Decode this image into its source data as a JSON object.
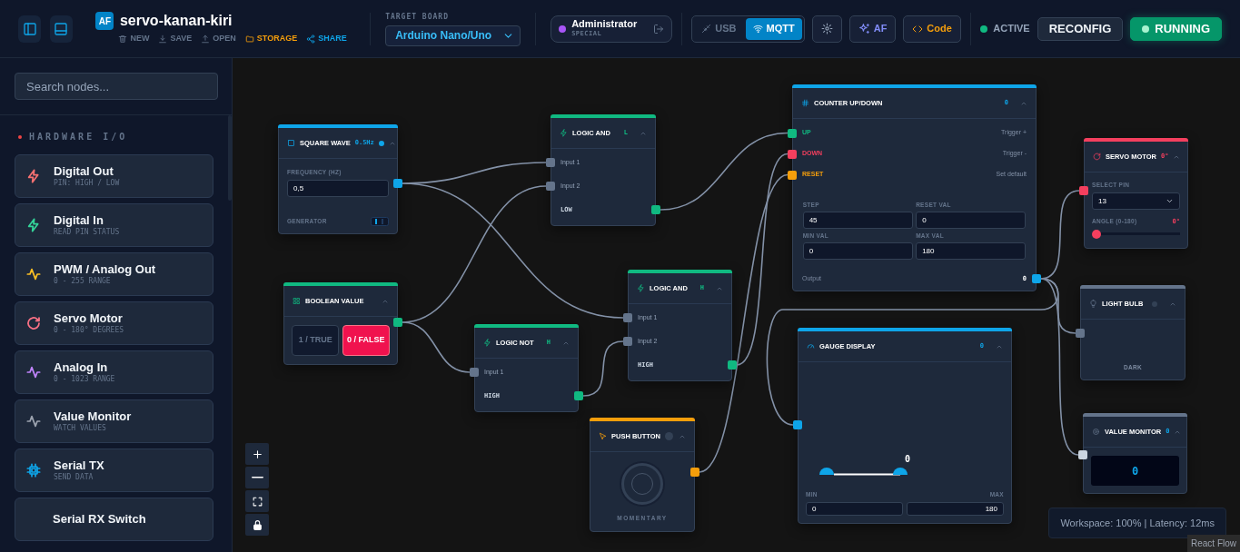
{
  "header": {
    "logo": "AF",
    "project_name": "servo-kanan-kiri",
    "actions": [
      {
        "label": "NEW",
        "kind": "new"
      },
      {
        "label": "SAVE",
        "kind": "save"
      },
      {
        "label": "OPEN",
        "kind": "open"
      },
      {
        "label": "STORAGE",
        "kind": "storage"
      },
      {
        "label": "SHARE",
        "kind": "share"
      }
    ],
    "target_board": {
      "label": "TARGET BOARD",
      "value": "Arduino Nano/Uno"
    },
    "user": {
      "name": "Administrator",
      "role": "SPECIAL"
    },
    "connection_modes": [
      {
        "label": "USB",
        "kind": "usb",
        "selected": false
      },
      {
        "label": "MQTT",
        "kind": "mqtt",
        "selected": true
      }
    ],
    "ai_button": "AF",
    "code_button": "Code",
    "status": {
      "label": "ACTIVE",
      "on": true
    },
    "reconfig_button": "RECONFIG",
    "run_button": {
      "label": "RUNNING",
      "running": true
    }
  },
  "sidebar": {
    "search": {
      "placeholder": "Search nodes..."
    },
    "section": {
      "title": "HARDWARE I/O",
      "color": "#ef4444"
    },
    "items": [
      {
        "title": "Digital Out",
        "subtitle": "PIN: HIGH / LOW",
        "kind": "bolt",
        "color": "#f87171"
      },
      {
        "title": "Digital In",
        "subtitle": "READ PIN STATUS",
        "kind": "bolt",
        "color": "#34d399"
      },
      {
        "title": "PWM / Analog Out",
        "subtitle": "0 - 255 RANGE",
        "kind": "wave",
        "color": "#fbbf24"
      },
      {
        "title": "Servo Motor",
        "subtitle": "0 - 180° DEGREES",
        "kind": "refresh",
        "color": "#fb7185"
      },
      {
        "title": "Analog In",
        "subtitle": "0 - 1023 RANGE",
        "kind": "wave",
        "color": "#c084fc"
      },
      {
        "title": "Value Monitor",
        "subtitle": "WATCH VALUES",
        "kind": "wave",
        "color": "#9ca3af"
      },
      {
        "title": "Serial TX",
        "subtitle": "SEND DATA",
        "kind": "chip",
        "color": "#0ea5e9"
      },
      {
        "title": "Serial RX Switch"
      }
    ]
  },
  "canvas": {
    "nodes": [
      {
        "kind": "square_wave",
        "title": "SQUARE WAVE",
        "color": "#0ea5e9",
        "badge": "0.5Hz",
        "signal_on": true,
        "field_label": "FREQUENCY (HZ)",
        "value": "0,5",
        "footer": "GENERATOR"
      },
      {
        "kind": "logic",
        "title": "LOGIC AND",
        "color": "#10b981",
        "badge": "L",
        "inputs": [
          "Input 1",
          "Input 2"
        ],
        "output": "LOW"
      },
      {
        "kind": "boolean",
        "title": "BOOLEAN VALUE",
        "color": "#10b981",
        "options": [
          {
            "label": "1 / TRUE",
            "selected": false
          },
          {
            "label": "0 / FALSE",
            "selected": true
          }
        ]
      },
      {
        "kind": "logic",
        "title": "LOGIC NOT",
        "color": "#10b981",
        "badge": "H",
        "inputs": [
          "Input 1"
        ],
        "output": "HIGH"
      },
      {
        "kind": "logic",
        "title": "LOGIC AND",
        "color": "#10b981",
        "badge": "H",
        "inputs": [
          "Input 1",
          "Input 2"
        ],
        "output": "HIGH"
      },
      {
        "kind": "push_button",
        "title": "PUSH BUTTON",
        "color": "#f59e0b",
        "pressed": false,
        "caption": "MOMENTARY"
      },
      {
        "kind": "counter",
        "title": "COUNTER UP/DOWN",
        "color": "#0ea5e9",
        "badge": "0",
        "ports": [
          {
            "label": "UP",
            "hint": "Trigger +",
            "color": "#10b981"
          },
          {
            "label": "DOWN",
            "hint": "Trigger -",
            "color": "#f43f5e"
          },
          {
            "label": "RESET",
            "hint": "Set default",
            "color": "#f59e0b"
          }
        ],
        "fields": [
          {
            "label": "STEP",
            "value": "45"
          },
          {
            "label": "RESET VAL",
            "value": "0"
          },
          {
            "label": "MIN VAL",
            "value": "0"
          },
          {
            "label": "MAX VAL",
            "value": "180"
          }
        ],
        "output_label": "Output",
        "output_value": "0"
      },
      {
        "kind": "gauge",
        "title": "GAUGE DISPLAY",
        "color": "#0ea5e9",
        "badge": "0",
        "reading": "0",
        "min": {
          "label": "MIN",
          "value": "0"
        },
        "max": {
          "label": "MAX",
          "value": "180"
        }
      },
      {
        "kind": "servo",
        "title": "SERVO MOTOR",
        "color": "#f43f5e",
        "badge": "0°",
        "pin_label": "SELECT PIN",
        "pin": "13",
        "angle_label": "ANGLE (0-180)",
        "angle": "0°",
        "level": 0
      },
      {
        "kind": "light_bulb",
        "title": "LIGHT BULB",
        "color": "#64748b",
        "on": false,
        "caption": "DARK"
      },
      {
        "kind": "value_monitor",
        "title": "VALUE MONITOR",
        "color": "#64748b",
        "badge": "0",
        "display": "0"
      }
    ],
    "workspace_status": "Workspace: 100% | Latency: 12ms",
    "attribution": "React Flow"
  }
}
